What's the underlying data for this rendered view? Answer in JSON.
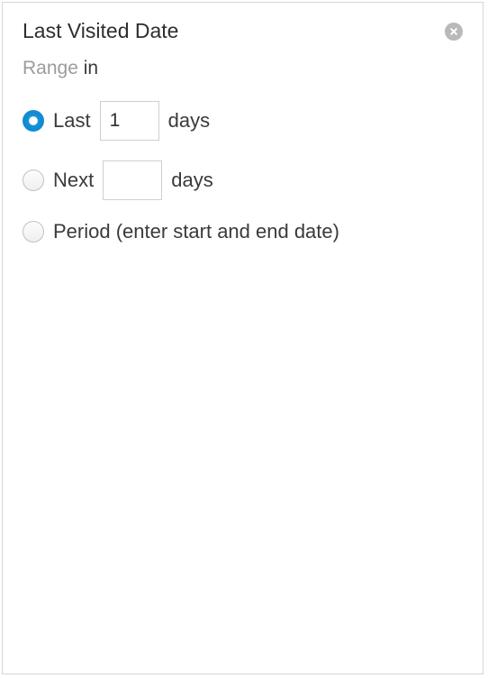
{
  "panel": {
    "title": "Last Visited Date",
    "subheader_prefix": "Range",
    "subheader_suffix": "in",
    "options": {
      "last": {
        "label_prefix": "Last",
        "value": "1",
        "label_suffix": "days",
        "selected": true
      },
      "next": {
        "label_prefix": "Next",
        "value": "",
        "label_suffix": "days",
        "selected": false
      },
      "period": {
        "label": "Period (enter start and end date)",
        "selected": false
      }
    }
  }
}
